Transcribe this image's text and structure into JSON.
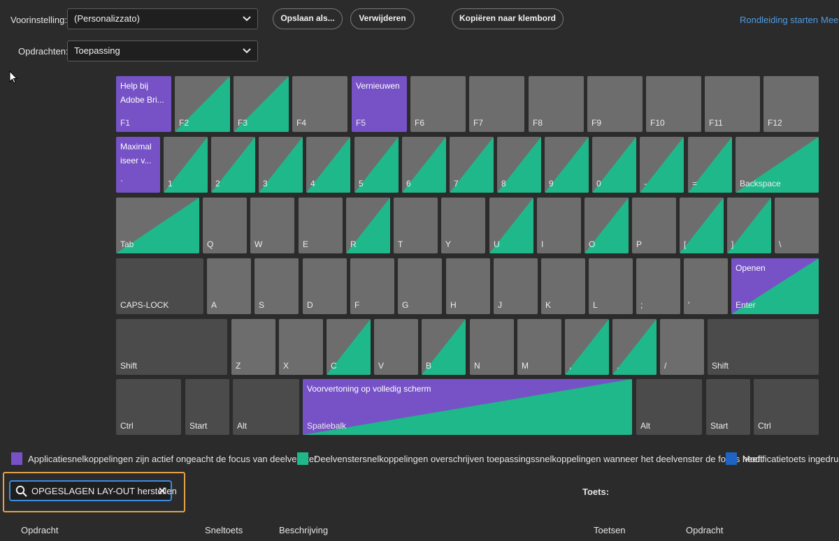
{
  "toolbar": {
    "preset_label": "Voorinstelling:",
    "preset_value": "(Personalizzato)",
    "commands_label": "Opdrachten:",
    "commands_value": "Toepassing",
    "save_as": "Opslaan als...",
    "delete": "Verwijderen",
    "copy_clipboard": "Kopiëren naar klembord",
    "tour": "Rondleiding starten",
    "more": "Meer"
  },
  "colors": {
    "application": "#7652c6",
    "panel": "#1fb88b",
    "modifier": "#1f63c4",
    "key": "#6d6d6d",
    "key_dark": "#4b4b4b"
  },
  "keyboard": {
    "rows": [
      [
        {
          "label": "F1",
          "fill": "purple",
          "command": "Help bij Adobe Bri..."
        },
        {
          "label": "F2",
          "fill": "panel"
        },
        {
          "label": "F3",
          "fill": "panel"
        },
        {
          "label": "F4",
          "fill": "none"
        },
        {
          "label": "F5",
          "fill": "purple",
          "command": "Vernieuwen"
        },
        {
          "label": "F6",
          "fill": "none"
        },
        {
          "label": "F7",
          "fill": "none"
        },
        {
          "label": "F8",
          "fill": "none"
        },
        {
          "label": "F9",
          "fill": "none"
        },
        {
          "label": "F10",
          "fill": "none"
        },
        {
          "label": "F11",
          "fill": "none"
        },
        {
          "label": "F12",
          "fill": "none"
        }
      ],
      [
        {
          "label": "`",
          "fill": "purple",
          "command": "Maximal iseer v..."
        },
        {
          "label": "1",
          "fill": "panel"
        },
        {
          "label": "2",
          "fill": "panel"
        },
        {
          "label": "3",
          "fill": "panel"
        },
        {
          "label": "4",
          "fill": "panel"
        },
        {
          "label": "5",
          "fill": "panel"
        },
        {
          "label": "6",
          "fill": "panel"
        },
        {
          "label": "7",
          "fill": "panel"
        },
        {
          "label": "8",
          "fill": "panel"
        },
        {
          "label": "9",
          "fill": "panel"
        },
        {
          "label": "0",
          "fill": "panel"
        },
        {
          "label": "-",
          "fill": "panel"
        },
        {
          "label": "=",
          "fill": "panel"
        },
        {
          "label": "Backspace",
          "fill": "panel"
        }
      ],
      [
        {
          "label": "Tab",
          "fill": "panel"
        },
        {
          "label": "Q",
          "fill": "none"
        },
        {
          "label": "W",
          "fill": "none"
        },
        {
          "label": "E",
          "fill": "none"
        },
        {
          "label": "R",
          "fill": "panel"
        },
        {
          "label": "T",
          "fill": "none"
        },
        {
          "label": "Y",
          "fill": "none"
        },
        {
          "label": "U",
          "fill": "panel"
        },
        {
          "label": "I",
          "fill": "none"
        },
        {
          "label": "O",
          "fill": "panel"
        },
        {
          "label": "P",
          "fill": "none"
        },
        {
          "label": "[",
          "fill": "panel"
        },
        {
          "label": "]",
          "fill": "panel"
        },
        {
          "label": "\\",
          "fill": "none"
        }
      ],
      [
        {
          "label": "CAPS-LOCK",
          "fill": "dark"
        },
        {
          "label": "A",
          "fill": "none"
        },
        {
          "label": "S",
          "fill": "none"
        },
        {
          "label": "D",
          "fill": "none"
        },
        {
          "label": "F",
          "fill": "none"
        },
        {
          "label": "G",
          "fill": "none"
        },
        {
          "label": "H",
          "fill": "none"
        },
        {
          "label": "J",
          "fill": "none"
        },
        {
          "label": "K",
          "fill": "none"
        },
        {
          "label": "L",
          "fill": "none"
        },
        {
          "label": ";",
          "fill": "none"
        },
        {
          "label": "'",
          "fill": "none"
        },
        {
          "label": "Enter",
          "fill": "both",
          "command": "Openen"
        }
      ],
      [
        {
          "label": "Shift",
          "fill": "dark"
        },
        {
          "label": "Z",
          "fill": "none"
        },
        {
          "label": "X",
          "fill": "none"
        },
        {
          "label": "C",
          "fill": "panel"
        },
        {
          "label": "V",
          "fill": "none"
        },
        {
          "label": "B",
          "fill": "panel"
        },
        {
          "label": "N",
          "fill": "none"
        },
        {
          "label": "M",
          "fill": "none"
        },
        {
          "label": ",",
          "fill": "panel"
        },
        {
          "label": ".",
          "fill": "panel"
        },
        {
          "label": "/",
          "fill": "none"
        },
        {
          "label": "Shift",
          "fill": "dark"
        }
      ],
      [
        {
          "label": "Ctrl",
          "fill": "dark"
        },
        {
          "label": "Start",
          "fill": "dark"
        },
        {
          "label": "Alt",
          "fill": "dark"
        },
        {
          "label": "Spatiebalk",
          "fill": "both",
          "command": "Voorvertoning op volledig scherm"
        },
        {
          "label": "Alt",
          "fill": "dark"
        },
        {
          "label": "Start",
          "fill": "dark"
        },
        {
          "label": "Ctrl",
          "fill": "dark"
        }
      ]
    ]
  },
  "legend": [
    {
      "text": "Applicatiesnelkoppelingen zijn actief ongeacht de focus van deelvenster",
      "color": "#7652c6"
    },
    {
      "text": "Deelvenstersnelkoppelingen overschrijven toepassingssnelkoppelingen wanneer het deelvenster de focus heeft",
      "color": "#1fb88b"
    },
    {
      "text": "Modificatietoets ingedrukt",
      "color": "#1f63c4"
    }
  ],
  "search": {
    "value": "OPGESLAGEN LAY-OUT herstellen"
  },
  "key_panel": {
    "label": "Toets:"
  },
  "table_headers": {
    "command": "Opdracht",
    "shortcut": "Sneltoets",
    "description": "Beschrijving",
    "keys": "Toetsen",
    "command2": "Opdracht"
  }
}
